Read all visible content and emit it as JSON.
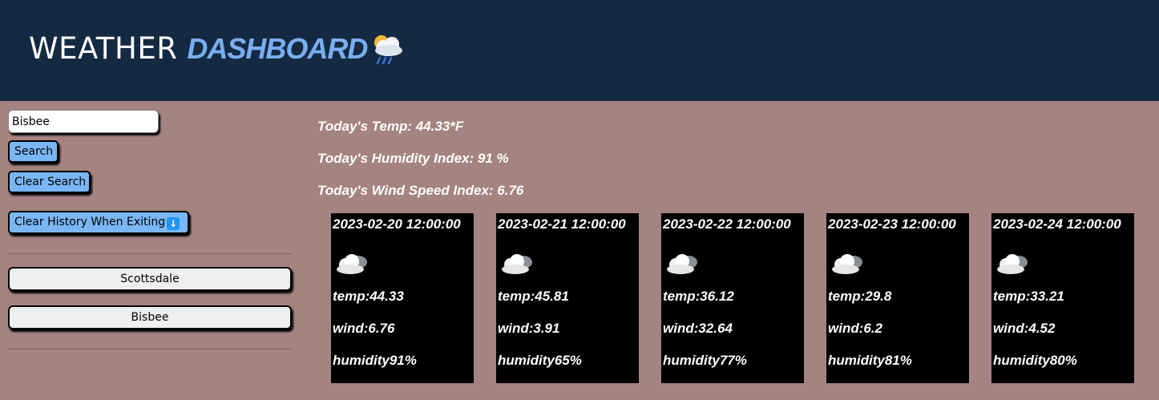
{
  "header": {
    "title_main": "WEATHER",
    "title_accent": "DASHBOARD",
    "title_icon": "cloud-rain-sun-icon"
  },
  "search": {
    "value": "Bisbee",
    "search_label": "Search",
    "clear_label": "Clear Search",
    "clear_history_label": "Clear History When Exiting",
    "clear_history_icon": "down-arrow-icon"
  },
  "history": [
    "Scottsdale",
    "Bisbee"
  ],
  "today": {
    "temp": "Today's Temp: 44.33*F",
    "humidity": "Today's Humidity Index: 91 %",
    "wind": "Today's Wind Speed Index: 6.76"
  },
  "forecast": [
    {
      "date": "2023-02-20 12:00:00",
      "icon": "cloudy-icon",
      "temp": "temp:44.33",
      "wind": "wind:6.76",
      "humidity": "humidity91%"
    },
    {
      "date": "2023-02-21 12:00:00",
      "icon": "cloudy-icon",
      "temp": "temp:45.81",
      "wind": "wind:3.91",
      "humidity": "humidity65%"
    },
    {
      "date": "2023-02-22 12:00:00",
      "icon": "cloudy-icon",
      "temp": "temp:36.12",
      "wind": "wind:32.64",
      "humidity": "humidity77%"
    },
    {
      "date": "2023-02-23 12:00:00",
      "icon": "cloudy-icon",
      "temp": "temp:29.8",
      "wind": "wind:6.2",
      "humidity": "humidity81%"
    },
    {
      "date": "2023-02-24 12:00:00",
      "icon": "cloudy-icon",
      "temp": "temp:33.21",
      "wind": "wind:4.52",
      "humidity": "humidity80%"
    }
  ],
  "colors": {
    "header_bg": "#142a42",
    "page_bg": "#a58381",
    "accent": "#79aef0",
    "button_blue": "#7ab6f4",
    "card_bg": "#000000"
  }
}
